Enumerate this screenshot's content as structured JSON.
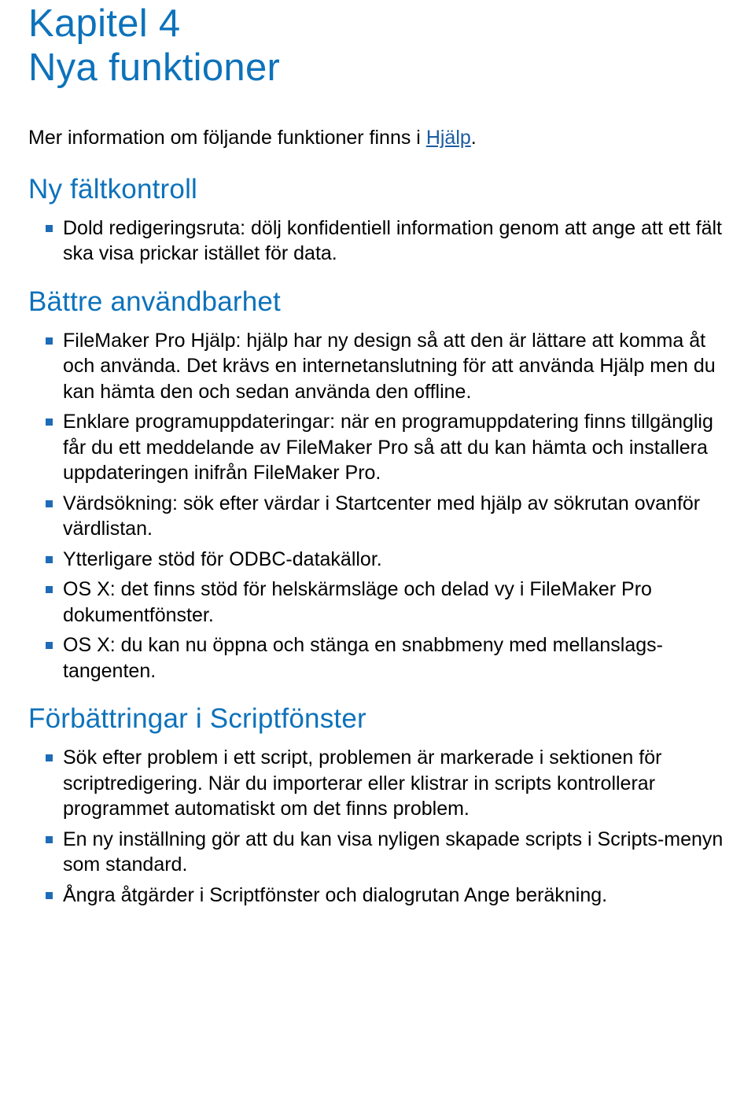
{
  "chapter": {
    "number_label": "Kapitel 4",
    "title": "Nya funktioner"
  },
  "intro": {
    "prefix": "Mer information om följande funktioner finns i ",
    "link_text": "Hjälp",
    "suffix": "."
  },
  "sections": {
    "faltkontroll": {
      "heading": "Ny fältkontroll",
      "items": [
        "Dold redigeringsruta: dölj konfidentiell information genom att ange att ett fält ska visa prickar istället för data."
      ]
    },
    "anvandbarhet": {
      "heading": "Bättre användbarhet",
      "items": [
        "FileMaker Pro Hjälp: hjälp har ny design så att den är lättare att komma åt och använda. Det krävs en internetanslutning för att använda Hjälp men du kan hämta den och sedan använda den offline.",
        "Enklare programuppdateringar: när en programuppdatering finns tillgänglig får du ett meddelande av FileMaker Pro så att du kan hämta och installera uppdateringen inifrån FileMaker Pro.",
        "Värdsökning: sök efter värdar i Startcenter med hjälp av sökrutan ovanför värdlistan.",
        "Ytterligare stöd för ODBC-datakällor.",
        "OS X: det finns stöd för helskärmsläge och delad vy i FileMaker Pro dokumentfönster.",
        "OS X: du kan nu öppna och stänga en snabbmeny med mellanslags­tangenten."
      ]
    },
    "scriptfonster": {
      "heading": "Förbättringar i Scriptfönster",
      "items": [
        "Sök efter problem i ett script, problemen är markerade i sektionen för scriptredigering. När du importerar eller klistrar in scripts kontrollerar programmet automatiskt om det finns problem.",
        "En ny inställning gör att du kan visa nyligen skapade scripts i Scripts-menyn som standard.",
        "Ångra åtgärder i Scriptfönster och dialogrutan Ange beräkning."
      ]
    }
  }
}
